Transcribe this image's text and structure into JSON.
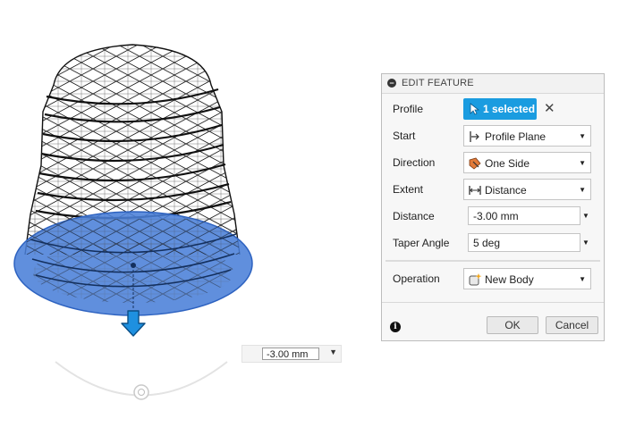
{
  "canvas": {
    "distance_input_value": "-3.00 mm"
  },
  "dialog": {
    "title": "EDIT FEATURE",
    "profile": {
      "label": "Profile",
      "selection_text": "1 selected"
    },
    "start": {
      "label": "Start",
      "value": "Profile Plane",
      "icon": "profile-plane-icon"
    },
    "direction": {
      "label": "Direction",
      "value": "One Side",
      "icon": "one-side-icon"
    },
    "extent": {
      "label": "Extent",
      "value": "Distance",
      "icon": "distance-icon"
    },
    "distance": {
      "label": "Distance",
      "value": "-3.00 mm"
    },
    "taper_angle": {
      "label": "Taper Angle",
      "value": "5 deg"
    },
    "operation": {
      "label": "Operation",
      "value": "New Body",
      "icon": "new-body-icon"
    },
    "ok_label": "OK",
    "cancel_label": "Cancel"
  },
  "colors": {
    "selection_blue": "#1a9ce0",
    "profile_fill": "#4a7fd8",
    "arrow_blue": "#1e90e0"
  }
}
